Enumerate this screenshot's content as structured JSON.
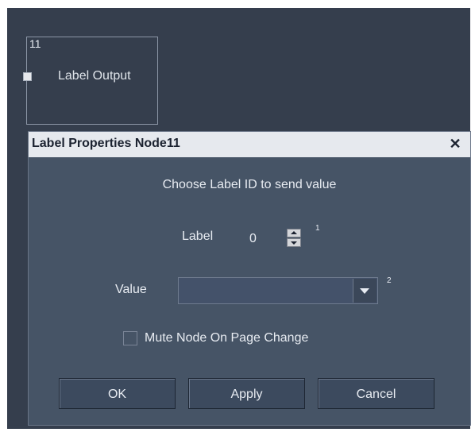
{
  "node": {
    "id": "11",
    "label": "Label Output"
  },
  "dialog": {
    "title": "Label Properties Node11",
    "close_symbol": "✕",
    "instruction": "Choose Label ID to send value",
    "label_field": {
      "label": "Label",
      "value": "0",
      "superscript": "1"
    },
    "value_field": {
      "label": "Value",
      "value": "",
      "superscript": "2"
    },
    "mute_checkbox": {
      "label": "Mute Node On Page Change",
      "checked": false
    },
    "buttons": {
      "ok": "OK",
      "apply": "Apply",
      "cancel": "Cancel"
    }
  },
  "colors": {
    "canvas": "#353e4d",
    "dialog_body": "#465466",
    "titlebar": "#e6e9ee",
    "text": "#e8ecf2"
  },
  "icons": [
    "close-icon",
    "spin-up-icon",
    "spin-down-icon",
    "dropdown-arrow-icon",
    "input-port-icon"
  ]
}
